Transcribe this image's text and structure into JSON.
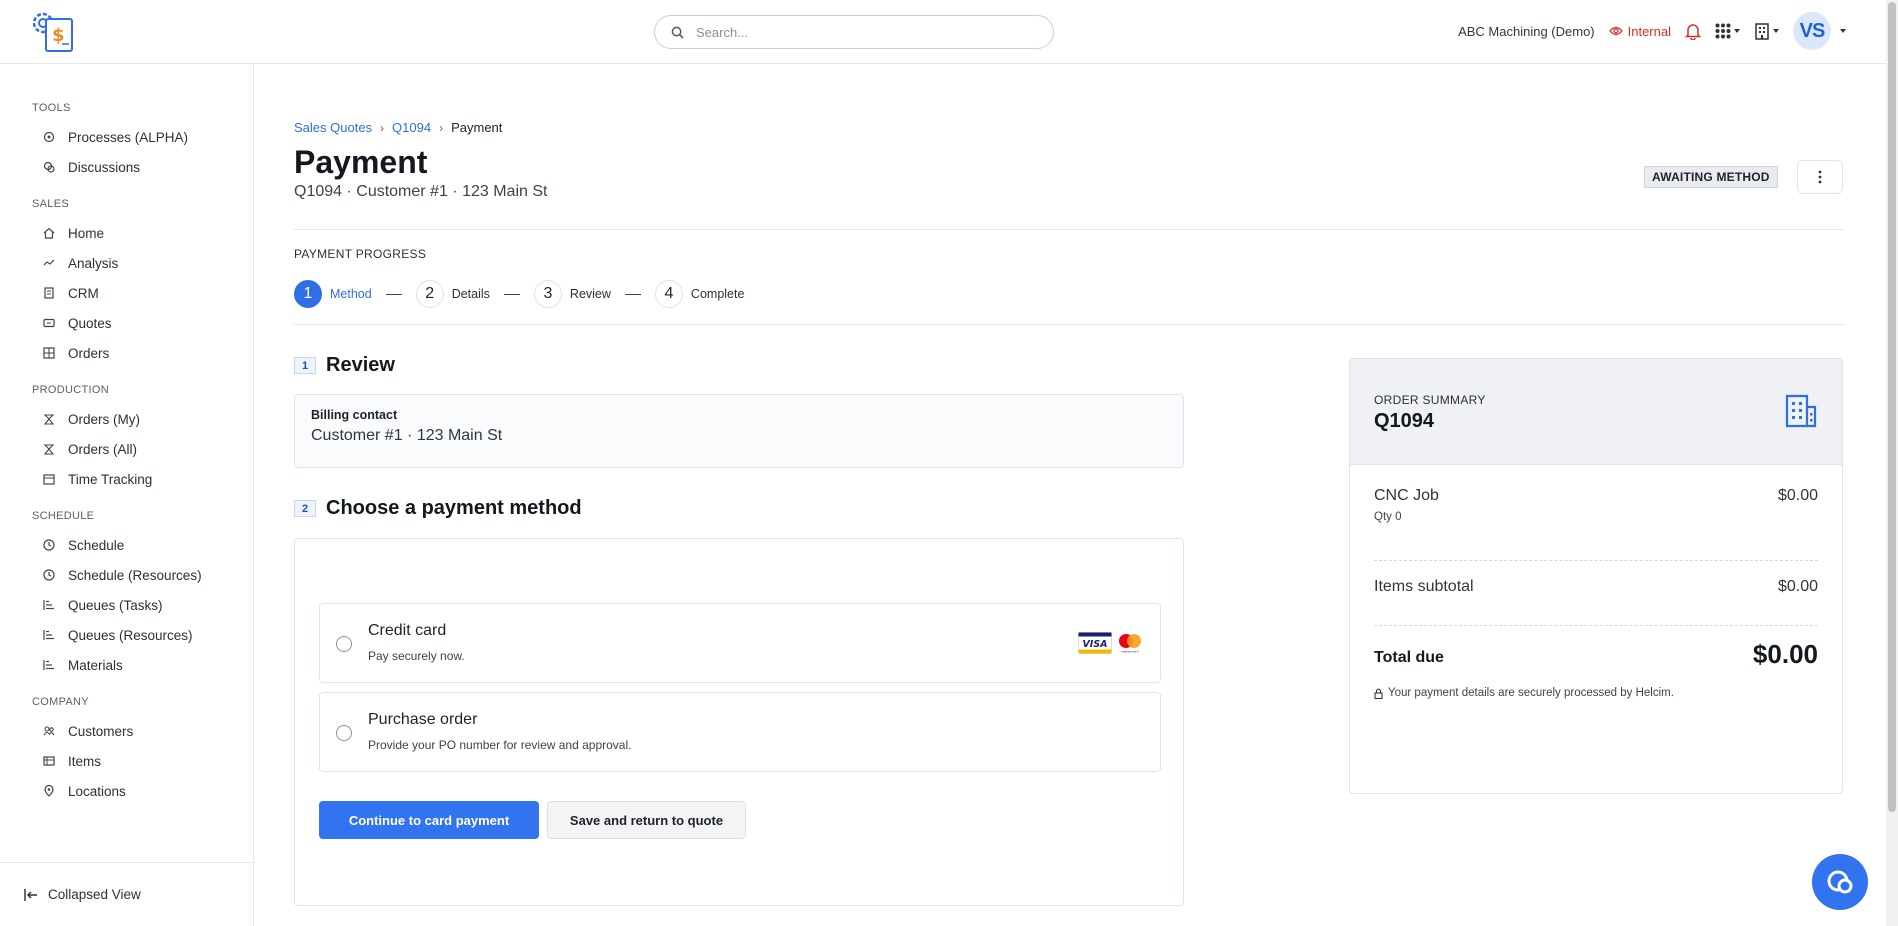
{
  "search": {
    "placeholder": "Search..."
  },
  "header": {
    "company": "ABC Machining (Demo)",
    "visibility": "Internal",
    "avatar_initials": "VS"
  },
  "sidebar": {
    "sections": [
      {
        "heading": "TOOLS",
        "items": [
          {
            "label": "Processes (ALPHA)",
            "icon": "process-icon"
          },
          {
            "label": "Discussions",
            "icon": "discussion-icon"
          }
        ]
      },
      {
        "heading": "SALES",
        "items": [
          {
            "label": "Home",
            "icon": "home-icon"
          },
          {
            "label": "Analysis",
            "icon": "analysis-icon"
          },
          {
            "label": "CRM",
            "icon": "crm-icon"
          },
          {
            "label": "Quotes",
            "icon": "quotes-icon"
          },
          {
            "label": "Orders",
            "icon": "orders-icon"
          }
        ]
      },
      {
        "heading": "PRODUCTION",
        "items": [
          {
            "label": "Orders (My)",
            "icon": "orders-my-icon"
          },
          {
            "label": "Orders (All)",
            "icon": "orders-all-icon"
          },
          {
            "label": "Time Tracking",
            "icon": "calendar-icon"
          }
        ]
      },
      {
        "heading": "SCHEDULE",
        "items": [
          {
            "label": "Schedule",
            "icon": "clock-icon"
          },
          {
            "label": "Schedule (Resources)",
            "icon": "clock-icon"
          },
          {
            "label": "Queues (Tasks)",
            "icon": "queue-icon"
          },
          {
            "label": "Queues (Resources)",
            "icon": "queue-icon"
          },
          {
            "label": "Materials",
            "icon": "queue-icon"
          }
        ]
      },
      {
        "heading": "COMPANY",
        "items": [
          {
            "label": "Customers",
            "icon": "customers-icon"
          },
          {
            "label": "Items",
            "icon": "items-icon"
          },
          {
            "label": "Locations",
            "icon": "location-icon"
          }
        ]
      }
    ],
    "collapse_label": "Collapsed View"
  },
  "breadcrumb": {
    "items": [
      "Sales Quotes",
      "Q1094"
    ],
    "current": "Payment"
  },
  "page": {
    "title": "Payment",
    "subtitle": "Q1094 · Customer #1 · 123 Main St",
    "status": "AWAITING METHOD"
  },
  "progress": {
    "label": "PAYMENT PROGRESS",
    "steps": [
      {
        "num": "1",
        "label": "Method"
      },
      {
        "num": "2",
        "label": "Details"
      },
      {
        "num": "3",
        "label": "Review"
      },
      {
        "num": "4",
        "label": "Complete"
      }
    ],
    "active_step": 1
  },
  "review": {
    "num": "1",
    "title": "Review",
    "billing_label": "Billing contact",
    "billing_value": "Customer #1 · 123 Main St"
  },
  "method": {
    "num": "2",
    "title": "Choose a payment method",
    "options": [
      {
        "title": "Credit card",
        "desc": "Pay securely now."
      },
      {
        "title": "Purchase order",
        "desc": "Provide your PO number for review and approval."
      }
    ],
    "card_brands": {
      "visa": "VISA",
      "mastercard": "mastercard"
    },
    "continue_label": "Continue to card payment",
    "save_label": "Save and return to quote"
  },
  "summary": {
    "label": "ORDER SUMMARY",
    "id": "Q1094",
    "item_name": "CNC Job",
    "item_qty": "Qty 0",
    "item_amount": "$0.00",
    "subtotal_label": "Items subtotal",
    "subtotal_amount": "$0.00",
    "total_label": "Total due",
    "total_amount": "$0.00",
    "secure_note": "Your payment details are securely processed by Helcim."
  },
  "colors": {
    "accent": "#3273ef",
    "internal": "#d93025",
    "link": "#2f6fdc"
  }
}
